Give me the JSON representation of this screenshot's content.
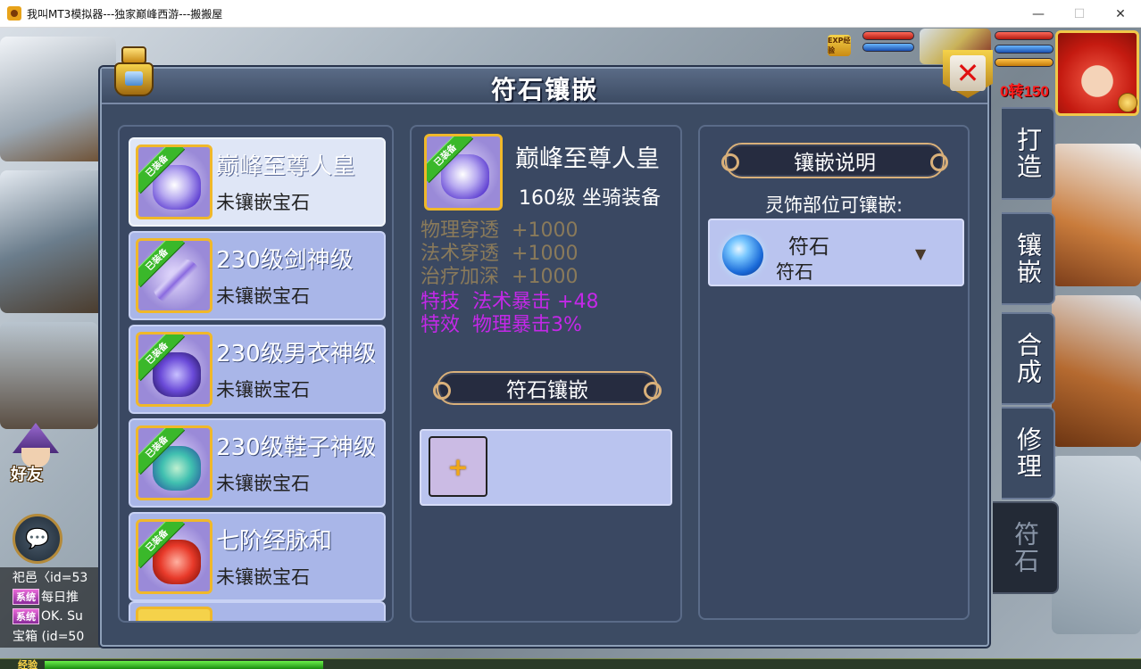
{
  "window": {
    "title": "我叫MT3模拟器---独家巅峰西游---搬搬屋",
    "minimize_glyph": "—",
    "maximize_glyph": "☐",
    "close_glyph": "✕"
  },
  "hud": {
    "exp_badge": "EXP经验",
    "level_text": "0转150",
    "friend_label": "好友",
    "chat_icon": "chat-bubble-icon",
    "exp_bar_label": "经验",
    "chat_lines": [
      {
        "tag": "",
        "text": "祀邑〈id=53"
      },
      {
        "tag": "系统",
        "text": "每日推"
      },
      {
        "tag": "系统",
        "text": "OK. Su"
      },
      {
        "tag": "",
        "text": "宝箱 (id=50"
      }
    ]
  },
  "dialog": {
    "title": "符石镶嵌",
    "close_glyph": "✕"
  },
  "equipment_list": {
    "equipped_ribbon": "已装备",
    "items": [
      {
        "name": "巅峰至尊人皇",
        "status": "未镶嵌宝石",
        "icon": "mount-icon",
        "selected": true
      },
      {
        "name": "230级剑神级",
        "status": "未镶嵌宝石",
        "icon": "sword-icon",
        "selected": false
      },
      {
        "name": "230级男衣神级",
        "status": "未镶嵌宝石",
        "icon": "armor-icon",
        "selected": false
      },
      {
        "name": "230级鞋子神级",
        "status": "未镶嵌宝石",
        "icon": "shoes-icon",
        "selected": false
      },
      {
        "name": "七阶经脉和",
        "status": "未镶嵌宝石",
        "icon": "orb-icon",
        "selected": false
      }
    ]
  },
  "selected_item": {
    "name": "巅峰至尊人皇",
    "meta": "160级  坐骑装备",
    "ribbon": "已装备",
    "base_stats": [
      {
        "label": "物理穿透",
        "value": "+1000"
      },
      {
        "label": "法术穿透",
        "value": "+1000"
      },
      {
        "label": "治疗加深",
        "value": "+1000"
      }
    ],
    "special_stats": [
      {
        "label": "特技",
        "value": "法术暴击  +48"
      },
      {
        "label": "特效",
        "value": "物理暴击3%"
      }
    ],
    "socket_section_title": "符石镶嵌",
    "add_slot_glyph": "+"
  },
  "info_panel": {
    "title": "镶嵌说明",
    "slot_label": "灵饰部位可镶嵌:",
    "gem": {
      "title": "符石",
      "subtitle": "符石",
      "icon": "sapphire-gem-icon"
    },
    "dropdown_glyph": "▼"
  },
  "side_tabs": [
    {
      "label": "打造",
      "active": false
    },
    {
      "label": "镶嵌",
      "active": false
    },
    {
      "label": "合成",
      "active": false
    },
    {
      "label": "修理",
      "active": false
    },
    {
      "label": "符石",
      "active": true
    }
  ],
  "colors": {
    "panel_bg": "#3a4862",
    "item_bg": "#a9b6e8",
    "item_selected_bg": "#dfe6f6",
    "base_stat": "#8a7a5a",
    "special_stat": "#c428e8",
    "equipped_ribbon": "#3ab82a",
    "level_text": "#ff1a1a"
  }
}
